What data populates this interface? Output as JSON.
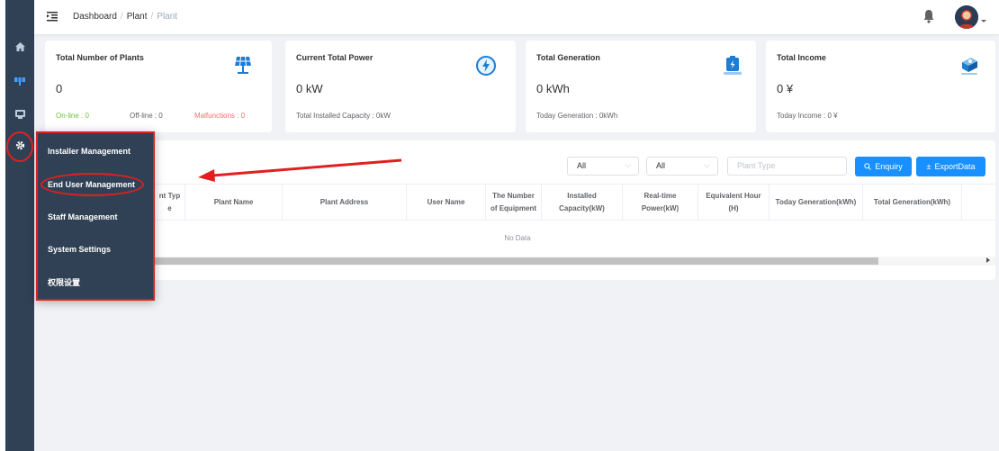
{
  "breadcrumb": {
    "first": "Dashboard",
    "second": "Plant",
    "third": "Plant",
    "separator": "/"
  },
  "sidebar": {
    "items": [
      {
        "icon": "home-icon"
      },
      {
        "icon": "plant-icon"
      },
      {
        "icon": "monitor-icon"
      },
      {
        "icon": "gear-icon"
      }
    ]
  },
  "cards": [
    {
      "title": "Total Number of Plants",
      "value": "0",
      "online": "On-line : 0",
      "offline": "Off-line : 0",
      "malfunctions": "Malfunctions : 0",
      "icon": "solar-panel-icon"
    },
    {
      "title": "Current Total Power",
      "value": "0 kW",
      "sub": "Total Installed Capacity : 0kW",
      "icon": "lightning-icon"
    },
    {
      "title": "Total Generation",
      "value": "0 kWh",
      "sub": "Today Generation : 0kWh",
      "icon": "battery-icon"
    },
    {
      "title": "Total Income",
      "value": "0 ¥",
      "sub": "Today Income : 0 ¥",
      "icon": "money-icon"
    }
  ],
  "filters": {
    "select1": "All",
    "select2": "All",
    "plant_type_placeholder": "Plant Type",
    "enquiry_label": "Enquiry",
    "export_label": "ExportData"
  },
  "table": {
    "headers": [
      "Plant Type",
      "Plant Name",
      "Plant Address",
      "User Name",
      "The Number of Equipment",
      "Installed Capacity(kW)",
      "Real-time Power(kW)",
      "Equivalent Hour (H)",
      "Today Generation(kWh)",
      "Total Generation(kWh)"
    ],
    "partial_header_1": "nt Typ",
    "partial_header_2": "e",
    "empty_text": "No Data"
  },
  "dropdown": {
    "items": [
      "Installer Management",
      "End User Management",
      "Staff Management",
      "System Settings",
      "权限设置"
    ]
  },
  "colors": {
    "sidebar": "#304156",
    "accent": "#1890ff",
    "annotation": "#e02020",
    "online": "#67c23a",
    "malfunction": "#f56c6c"
  }
}
